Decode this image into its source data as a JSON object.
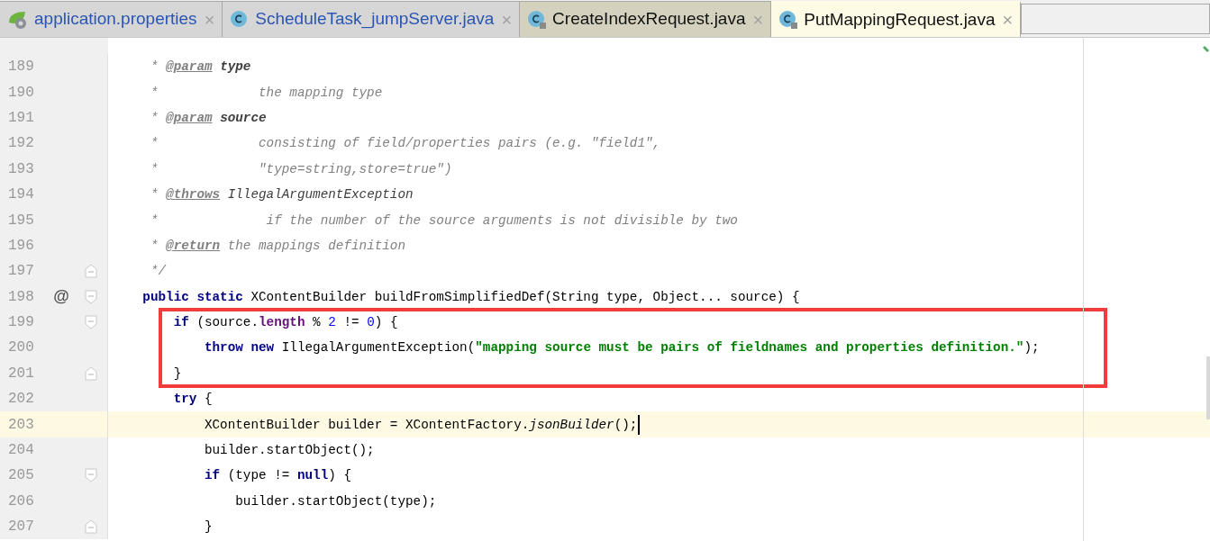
{
  "tabs": [
    {
      "label": "application.properties",
      "kind": "spring",
      "locked": false,
      "modified": true,
      "selected": false,
      "color": "#d6d6d6"
    },
    {
      "label": "ScheduleTask_jumpServer.java",
      "kind": "class",
      "locked": false,
      "modified": true,
      "selected": false,
      "color": "#d6d6d6"
    },
    {
      "label": "CreateIndexRequest.java",
      "kind": "class",
      "locked": true,
      "modified": false,
      "selected": false,
      "color": "#d4d2bf"
    },
    {
      "label": "PutMappingRequest.java",
      "kind": "class",
      "locked": true,
      "modified": false,
      "selected": true,
      "color": "#fdfbe6"
    }
  ],
  "close_mark": "×",
  "gutter_mark": "@",
  "lines": [
    {
      "number": "189",
      "kind": "code",
      "current": false,
      "boxed": false,
      "mark": false,
      "tokens": [
        {
          "t": "     * ",
          "kind": "comment"
        },
        {
          "t": "@param",
          "kind": "doctag"
        },
        {
          "t": " type",
          "kind": "docparam"
        }
      ]
    },
    {
      "number": "190",
      "kind": "code",
      "current": false,
      "boxed": false,
      "mark": false,
      "tokens": [
        {
          "t": "     *             the mapping type",
          "kind": "comment"
        }
      ]
    },
    {
      "number": "191",
      "kind": "code",
      "current": false,
      "boxed": false,
      "mark": false,
      "tokens": [
        {
          "t": "     * ",
          "kind": "comment"
        },
        {
          "t": "@param",
          "kind": "doctag"
        },
        {
          "t": " source",
          "kind": "docparam"
        }
      ]
    },
    {
      "number": "192",
      "kind": "code",
      "current": false,
      "boxed": false,
      "mark": false,
      "tokens": [
        {
          "t": "     *             consisting of field/properties pairs (e.g. \"field1\",",
          "kind": "comment"
        }
      ]
    },
    {
      "number": "193",
      "kind": "code",
      "current": false,
      "boxed": false,
      "mark": false,
      "tokens": [
        {
          "t": "     *             \"type=string,store=true\")",
          "kind": "comment"
        }
      ]
    },
    {
      "number": "194",
      "kind": "code",
      "current": false,
      "boxed": false,
      "mark": false,
      "tokens": [
        {
          "t": "     * ",
          "kind": "comment"
        },
        {
          "t": "@throws",
          "kind": "doctag"
        },
        {
          "t": " IllegalArgumentException",
          "kind": "docref"
        }
      ]
    },
    {
      "number": "195",
      "kind": "code",
      "current": false,
      "boxed": false,
      "mark": false,
      "tokens": [
        {
          "t": "     *              if the number of the source arguments is not divisible by two",
          "kind": "comment"
        }
      ]
    },
    {
      "number": "196",
      "kind": "code",
      "current": false,
      "boxed": false,
      "mark": false,
      "tokens": [
        {
          "t": "     * ",
          "kind": "comment"
        },
        {
          "t": "@return",
          "kind": "doctag"
        },
        {
          "t": " the mappings definition",
          "kind": "comment"
        }
      ]
    },
    {
      "number": "197",
      "kind": "fold-end",
      "current": false,
      "boxed": false,
      "mark": false,
      "tokens": [
        {
          "t": "     */",
          "kind": "comment"
        }
      ]
    },
    {
      "number": "198",
      "kind": "fold-start",
      "current": false,
      "boxed": false,
      "mark": true,
      "tokens": [
        {
          "t": "    public",
          "kind": "kw"
        },
        {
          "t": " static",
          "kind": "kw"
        },
        {
          "t": " XContentBuilder buildFromSimplifiedDef(String type, Object... source) {",
          "kind": "plain"
        }
      ]
    },
    {
      "number": "199",
      "kind": "fold-start",
      "current": false,
      "boxed": true,
      "mark": false,
      "tokens": [
        {
          "t": "        if",
          "kind": "kw"
        },
        {
          "t": " (source.",
          "kind": "plain"
        },
        {
          "t": "length",
          "kind": "field"
        },
        {
          "t": " % ",
          "kind": "plain"
        },
        {
          "t": "2",
          "kind": "number"
        },
        {
          "t": " != ",
          "kind": "plain"
        },
        {
          "t": "0",
          "kind": "number"
        },
        {
          "t": ") {",
          "kind": "plain"
        }
      ]
    },
    {
      "number": "200",
      "kind": "code",
      "current": false,
      "boxed": true,
      "mark": false,
      "tokens": [
        {
          "t": "            throw",
          "kind": "kw"
        },
        {
          "t": " new",
          "kind": "kw"
        },
        {
          "t": " IllegalArgumentException(",
          "kind": "plain"
        },
        {
          "t": "\"mapping source must be pairs of fieldnames and properties definition.\"",
          "kind": "string"
        },
        {
          "t": ");",
          "kind": "plain"
        }
      ]
    },
    {
      "number": "201",
      "kind": "fold-end",
      "current": false,
      "boxed": true,
      "mark": false,
      "tokens": [
        {
          "t": "        }",
          "kind": "plain"
        }
      ]
    },
    {
      "number": "202",
      "kind": "code",
      "current": false,
      "boxed": false,
      "mark": false,
      "tokens": [
        {
          "t": "        try",
          "kind": "kw"
        },
        {
          "t": " {",
          "kind": "plain"
        }
      ]
    },
    {
      "number": "203",
      "kind": "code",
      "current": true,
      "boxed": false,
      "mark": false,
      "tokens": [
        {
          "t": "            XContentBuilder builder = XContentFactory.",
          "kind": "plain"
        },
        {
          "t": "jsonBuilder",
          "kind": "static"
        },
        {
          "t": "();",
          "kind": "plain"
        }
      ]
    },
    {
      "number": "204",
      "kind": "code",
      "current": false,
      "boxed": false,
      "mark": false,
      "tokens": [
        {
          "t": "            builder.startObject();",
          "kind": "plain"
        }
      ]
    },
    {
      "number": "205",
      "kind": "fold-start",
      "current": false,
      "boxed": false,
      "mark": false,
      "tokens": [
        {
          "t": "            if",
          "kind": "kw"
        },
        {
          "t": " (type != ",
          "kind": "plain"
        },
        {
          "t": "null",
          "kind": "kw"
        },
        {
          "t": ") {",
          "kind": "plain"
        }
      ]
    },
    {
      "number": "206",
      "kind": "code",
      "current": false,
      "boxed": false,
      "mark": false,
      "tokens": [
        {
          "t": "                builder.startObject(type);",
          "kind": "plain"
        }
      ]
    },
    {
      "number": "207",
      "kind": "fold-end",
      "current": false,
      "boxed": false,
      "mark": false,
      "tokens": [
        {
          "t": "            }",
          "kind": "plain"
        }
      ]
    }
  ]
}
